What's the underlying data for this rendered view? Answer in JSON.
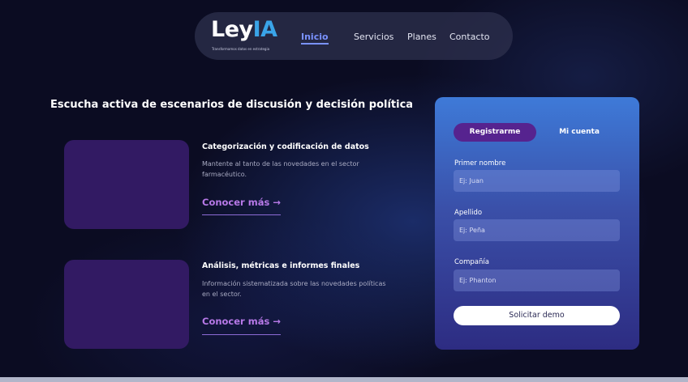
{
  "brand": {
    "name_part1": "Ley",
    "name_part2": "IA",
    "tagline": "Transformamos datos en estrategia"
  },
  "nav": {
    "items": [
      {
        "label": "Inicio",
        "active": true
      },
      {
        "label": "Servicios",
        "active": false
      },
      {
        "label": "Planes",
        "active": false
      },
      {
        "label": "Contacto",
        "active": false
      }
    ]
  },
  "hero": {
    "headline": "Escucha activa de escenarios de discusión y decisión política"
  },
  "services": [
    {
      "title": "Categorización y codificación de datos",
      "description": "Mantente al tanto de las novedades en el sector farmacéutico.",
      "link_label": "Conocer más",
      "link_icon": "arrow-right-icon"
    },
    {
      "title": "Análisis, métricas e informes finales",
      "description": "Información sistematizada sobre las novedades políticas en el sector.",
      "link_label": "Conocer más",
      "link_icon": "arrow-right-icon"
    }
  ],
  "form": {
    "tabs": [
      {
        "label": "Registrarme",
        "active": true
      },
      {
        "label": "Mi cuenta",
        "active": false
      }
    ],
    "fields": [
      {
        "label": "Primer nombre",
        "placeholder": "Ej: Juan",
        "value": ""
      },
      {
        "label": "Apellido",
        "placeholder": "Ej: Peña",
        "value": ""
      },
      {
        "label": "Compañía",
        "placeholder": "Ej: Phanton",
        "value": ""
      }
    ],
    "submit_label": "Solicitar demo"
  },
  "colors": {
    "background": "#0b0c22",
    "accent_nav": "#7a92ff",
    "accent_link": "#b779e8",
    "card_placeholder": "#321a63",
    "tab_active": "#56238f",
    "logo_ia": "#3aa4e8"
  }
}
